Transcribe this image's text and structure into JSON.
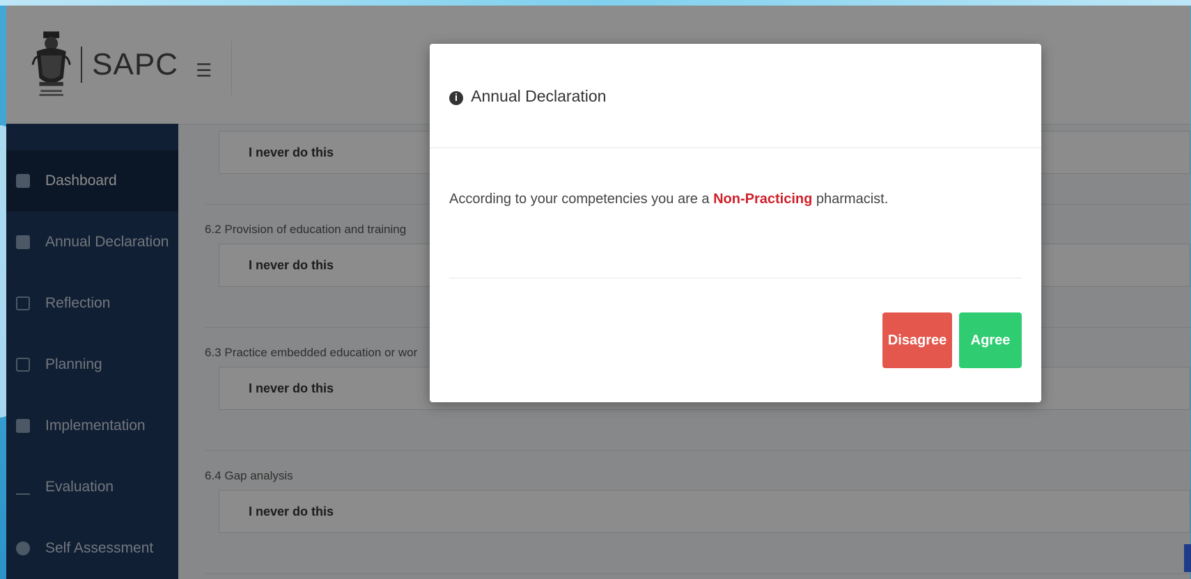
{
  "brand": {
    "name": "SAPC",
    "crest_text": "South African Pharmacy Council"
  },
  "sidebar": {
    "items": [
      {
        "label": "Dashboard",
        "icon": "dashboard-icon",
        "active": true
      },
      {
        "label": "Annual Declaration",
        "icon": "flag-icon"
      },
      {
        "label": "Reflection",
        "icon": "calendar-icon"
      },
      {
        "label": "Planning",
        "icon": "sign-in-icon"
      },
      {
        "label": "Implementation",
        "icon": "tasks-icon"
      },
      {
        "label": "Evaluation",
        "icon": "chart-icon"
      },
      {
        "label": "Self Assessment",
        "icon": "check-circle-icon"
      }
    ]
  },
  "questions": [
    {
      "label": "",
      "answer": "I never do this"
    },
    {
      "label": "6.2 Provision of education and training",
      "answer": "I never do this"
    },
    {
      "label": "6.3 Practice embedded education or wor",
      "answer": "I never do this"
    },
    {
      "label": "6.4 Gap analysis",
      "answer": "I never do this"
    }
  ],
  "modal": {
    "title": "Annual Declaration",
    "message_prefix": "According to your competencies you are a ",
    "message_highlight": "Non-Practicing",
    "message_suffix": " pharmacist.",
    "disagree_label": "Disagree",
    "agree_label": "Agree",
    "colors": {
      "disagree": "#e4574d",
      "agree": "#2fcc72",
      "highlight": "#d0202a"
    }
  }
}
